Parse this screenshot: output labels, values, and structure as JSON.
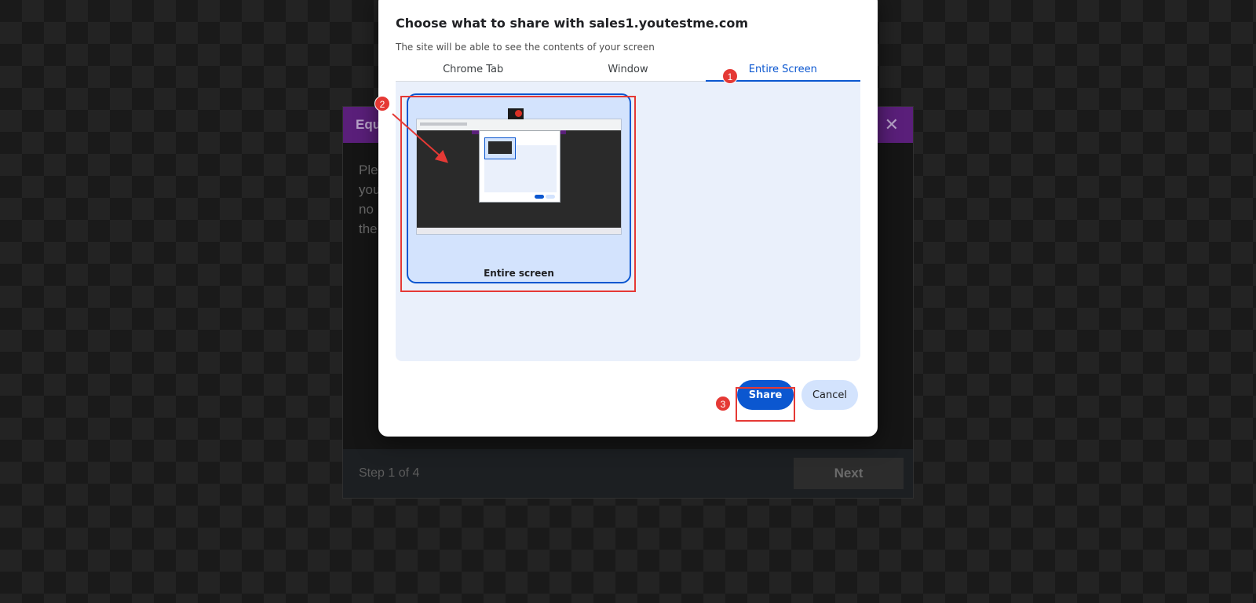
{
  "background_modal": {
    "title": "Equ",
    "body_lines": [
      "Ple",
      "you",
      "no",
      "the"
    ],
    "step": "Step 1 of 4",
    "next_label": "Next",
    "header_color": "#5a1f7a"
  },
  "dialog": {
    "title": "Choose what to share with sales1.youtestme.com",
    "subtitle": "The site will be able to see the contents of your screen",
    "tabs": [
      {
        "label": "Chrome Tab",
        "active": false
      },
      {
        "label": "Window",
        "active": false
      },
      {
        "label": "Entire Screen",
        "active": true
      }
    ],
    "source_card": {
      "label": "Entire screen",
      "selected": true
    },
    "share_label": "Share",
    "cancel_label": "Cancel",
    "accent_color": "#0b57d0"
  },
  "annotations": {
    "badges": [
      "1",
      "2",
      "3"
    ],
    "color": "#e53935"
  },
  "icons": {
    "close": "close-icon"
  }
}
